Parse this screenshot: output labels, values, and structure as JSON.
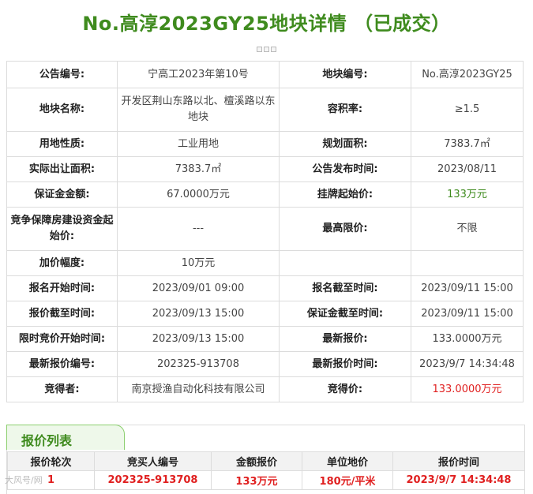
{
  "page": {
    "title": "No.高淳2023GY25地块详情 （已成交）"
  },
  "details": {
    "announcement_no_label": "公告编号:",
    "announcement_no": "宁高工2023年第10号",
    "plot_no_label": "地块编号:",
    "plot_no": "No.高淳2023GY25",
    "plot_name_label": "地块名称:",
    "plot_name": "开发区荆山东路以北、檀溪路以东地块",
    "far_label": "容积率:",
    "far": "≥1.5",
    "land_use_label": "用地性质:",
    "land_use": "工业用地",
    "planned_area_label": "规划面积:",
    "planned_area": "7383.7㎡",
    "transfer_area_label": "实际出让面积:",
    "transfer_area": "7383.7㎡",
    "publish_time_label": "公告发布时间:",
    "publish_time": "2023/08/11",
    "deposit_label": "保证金金额:",
    "deposit": "67.0000万元",
    "start_price_label": "挂牌起始价:",
    "start_price": "133万元",
    "housing_fund_label": "竞争保障房建设资金起始价:",
    "housing_fund": "---",
    "max_price_label": "最高限价:",
    "max_price": "不限",
    "increment_label": "加价幅度:",
    "increment": "10万元",
    "reg_start_label": "报名开始时间:",
    "reg_start": "2023/09/01 09:00",
    "reg_end_label": "报名截至时间:",
    "reg_end": "2023/09/11 15:00",
    "bid_end_label": "报价截至时间:",
    "bid_end": "2023/09/13 15:00",
    "deposit_end_label": "保证金截至时间:",
    "deposit_end": "2023/09/11 15:00",
    "timed_start_label": "限时竞价开始时间:",
    "timed_start": "2023/09/13 15:00",
    "latest_price_label": "最新报价:",
    "latest_price": "133.0000万元",
    "latest_bid_no_label": "最新报价编号:",
    "latest_bid_no": "202325-913708",
    "latest_bid_time_label": "最新报价时间:",
    "latest_bid_time": "2023/9/7 14:34:48",
    "winner_label": "竞得者:",
    "winner": "南京授渔自动化科技有限公司",
    "winning_price_label": "竞得价:",
    "winning_price": "133.0000万元"
  },
  "bid_list": {
    "tab_label": "报价列表",
    "headers": [
      "报价轮次",
      "竞买人编号",
      "金额报价",
      "单位地价",
      "报价时间"
    ],
    "rows": [
      [
        "1",
        "202325-913708",
        "133万元",
        "180元/平米",
        "2023/9/7 14:34:48"
      ]
    ]
  },
  "watermark": "大风号/网",
  "colors": {
    "accent_green": "#3f8b1e",
    "highlight_red": "#e02020"
  }
}
